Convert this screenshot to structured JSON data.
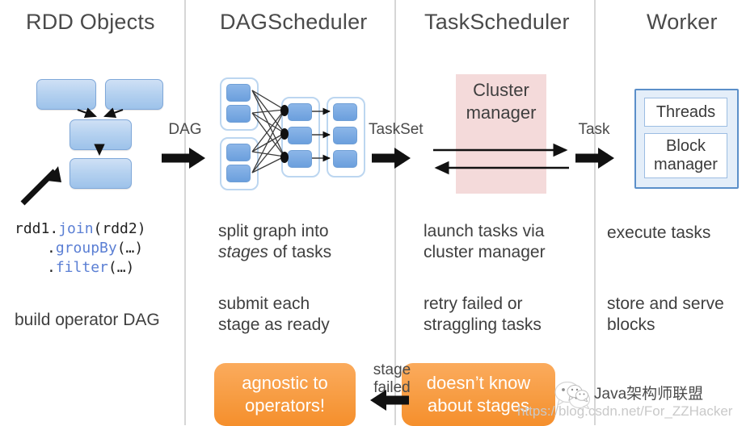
{
  "columns": [
    {
      "id": "rdd-objects",
      "title": "RDD Objects"
    },
    {
      "id": "dag-scheduler",
      "title": "DAGScheduler"
    },
    {
      "id": "task-scheduler",
      "title": "TaskScheduler"
    },
    {
      "id": "worker",
      "title": "Worker"
    }
  ],
  "flow_labels": {
    "dag": "DAG",
    "taskset": "TaskSet",
    "task": "Task",
    "stage_failed_line1": "stage",
    "stage_failed_line2": "failed"
  },
  "rdd": {
    "code_line1_obj": "rdd1.",
    "code_line1_method": "join",
    "code_line1_args": "(rdd2)",
    "code_line2_dot": ".",
    "code_line2_method": "groupBy",
    "code_line2_args": "(…)",
    "code_line3_dot": ".",
    "code_line3_method": "filter",
    "code_line3_args": "(…)",
    "caption": "build operator DAG"
  },
  "dag_scheduler": {
    "desc1_pre": "split graph into",
    "desc1_em": "stages",
    "desc1_post": " of tasks",
    "desc2_line1": "submit each",
    "desc2_line2": "stage as ready",
    "callout_line1": "agnostic to",
    "callout_line2": "operators!"
  },
  "task_scheduler": {
    "cluster_manager_line1": "Cluster",
    "cluster_manager_line2": "manager",
    "desc1_line1": "launch tasks via",
    "desc1_line2": "cluster manager",
    "desc2_line1": "retry failed or",
    "desc2_line2": "straggling tasks",
    "callout_line1": "doesn’t know",
    "callout_line2": "about stages"
  },
  "worker": {
    "threads": "Threads",
    "block_manager_line1": "Block",
    "block_manager_line2": "manager",
    "desc1": "execute tasks",
    "desc2_line1": "store and serve",
    "desc2_line2": "blocks"
  },
  "watermark": {
    "badge_text": "Java架构师联盟",
    "url": "https://blog.csdn.net/For_ZZHacker"
  },
  "colors": {
    "rdd_box_fill": "#b6d2f0",
    "rdd_box_border": "#7fa8d9",
    "dag_box_fill": "#6b9fdd",
    "cluster_manager_fill": "#f4dada",
    "orange_callout": "#f79c42",
    "worker_border": "#5b8fc9",
    "divider": "#d6d6d6",
    "code_method": "#5b7fd4"
  }
}
